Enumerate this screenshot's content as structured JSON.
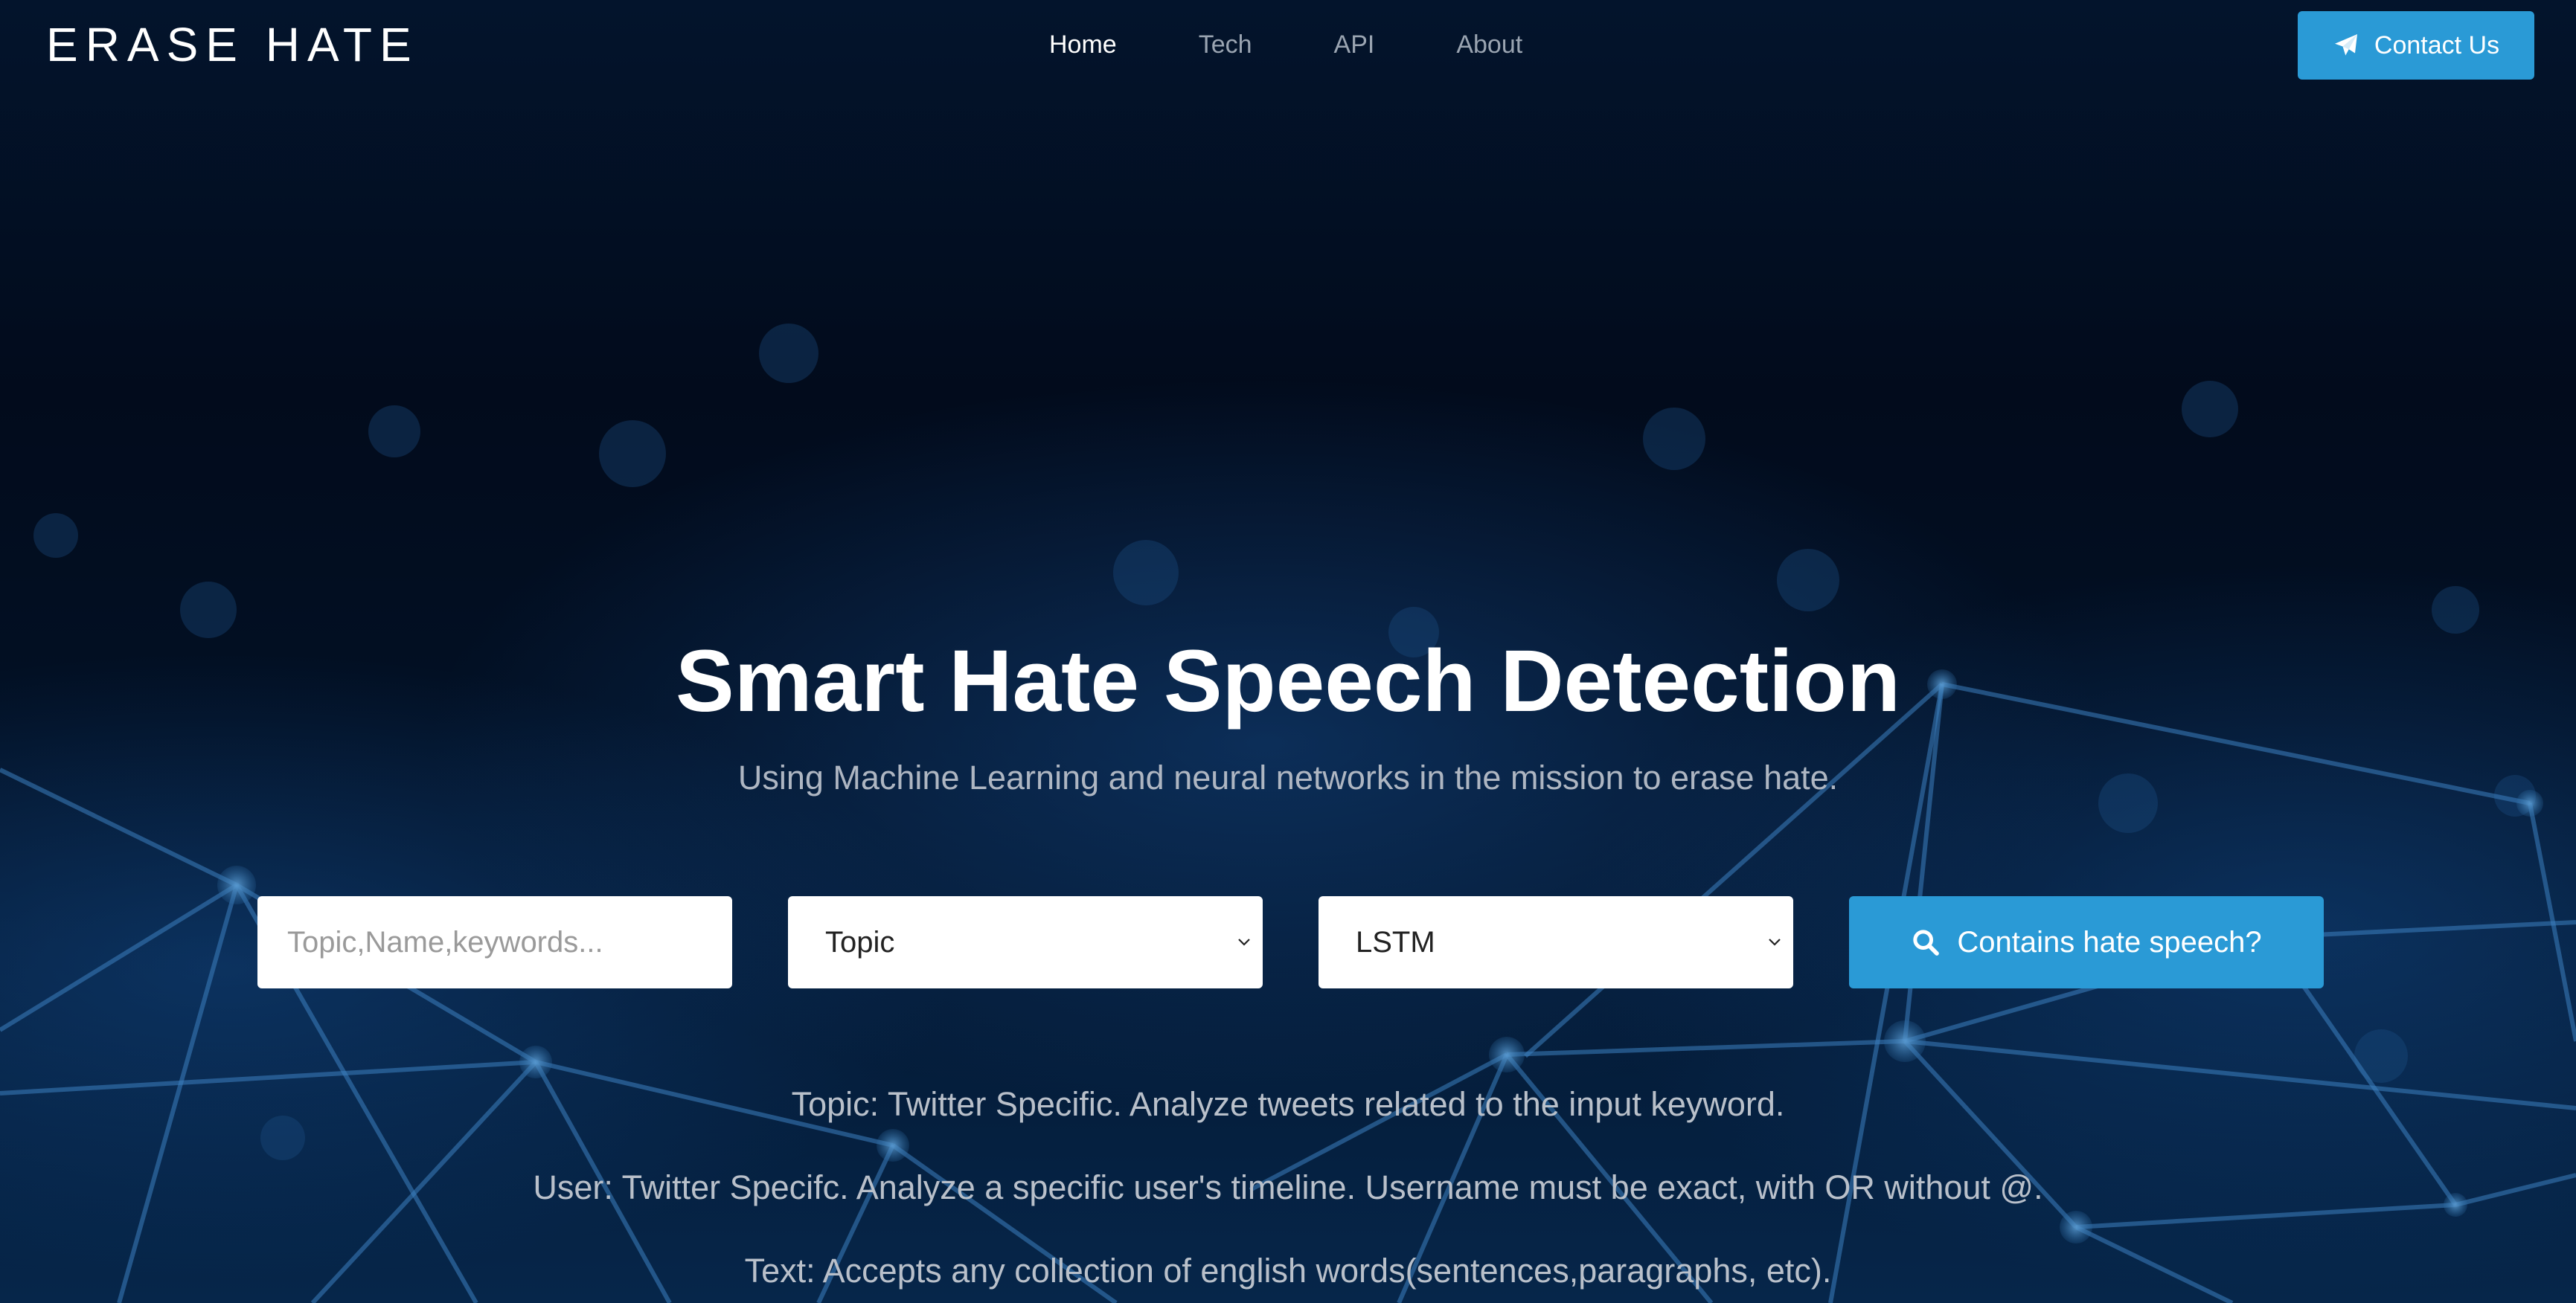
{
  "header": {
    "brand": "ERASE HATE",
    "nav": [
      {
        "label": "Home",
        "active": true
      },
      {
        "label": "Tech",
        "active": false
      },
      {
        "label": "API",
        "active": false
      },
      {
        "label": "About",
        "active": false
      }
    ],
    "contact_label": "Contact Us",
    "contact_icon": "paper-plane-icon"
  },
  "hero": {
    "title": "Smart Hate Speech Detection",
    "subtitle": "Using Machine Learning and neural networks in the mission to erase hate."
  },
  "search": {
    "placeholder": "Topic,Name,keywords...",
    "value": "",
    "mode_selected": "Topic",
    "model_selected": "LSTM",
    "button_label": "Contains hate speech?",
    "button_icon": "search-icon"
  },
  "info": {
    "topic": "Topic: Twitter Specific. Analyze tweets related to the input keyword.",
    "user": "User: Twitter Specifc. Analyze a specific user's timeline. Username must be exact, with OR without @.",
    "text": "Text: Accepts any collection of english words(sentences,paragraphs, etc)."
  },
  "colors": {
    "accent": "#2a9ad6",
    "background": "#020d1e",
    "muted_text": "#aeb6c2"
  }
}
